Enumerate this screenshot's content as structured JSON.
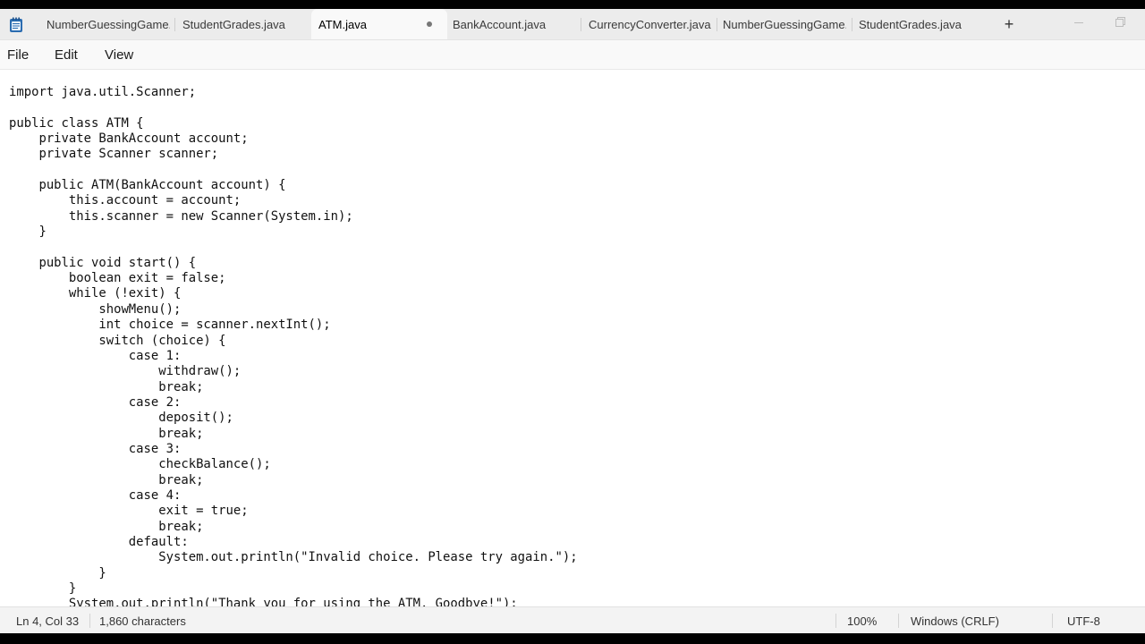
{
  "tabs": [
    {
      "label": "NumberGuessingGame.java",
      "active": false
    },
    {
      "label": "StudentGrades.java",
      "active": false
    },
    {
      "label": "ATM.java",
      "active": true
    },
    {
      "label": "BankAccount.java",
      "active": false
    },
    {
      "label": "CurrencyConverter.java",
      "active": false
    },
    {
      "label": "NumberGuessingGame.java",
      "active": false
    },
    {
      "label": "StudentGrades.java",
      "active": false
    }
  ],
  "new_tab_icon": "+",
  "menu": {
    "file": "File",
    "edit": "Edit",
    "view": "View"
  },
  "code_lines": [
    "import java.util.Scanner;",
    "",
    "public class ATM {",
    "    private BankAccount account;",
    "    private Scanner scanner;",
    "",
    "    public ATM(BankAccount account) {",
    "        this.account = account;",
    "        this.scanner = new Scanner(System.in);",
    "    }",
    "",
    "    public void start() {",
    "        boolean exit = false;",
    "        while (!exit) {",
    "            showMenu();",
    "            int choice = scanner.nextInt();",
    "            switch (choice) {",
    "                case 1:",
    "                    withdraw();",
    "                    break;",
    "                case 2:",
    "                    deposit();",
    "                    break;",
    "                case 3:",
    "                    checkBalance();",
    "                    break;",
    "                case 4:",
    "                    exit = true;",
    "                    break;",
    "                default:",
    "                    System.out.println(\"Invalid choice. Please try again.\");",
    "            }",
    "        }",
    "        System.out.println(\"Thank you for using the ATM. Goodbye!\");"
  ],
  "status": {
    "position": "Ln 4, Col 33",
    "characters": "1,860 characters",
    "zoom": "100%",
    "line_ending": "Windows (CRLF)",
    "encoding": "UTF-8"
  },
  "colors": {
    "tabbar_bg": "#ececec",
    "active_tab_bg": "#f9f9f9",
    "editor_bg": "#ffffff",
    "statusbar_bg": "#f3f3f3",
    "app_icon": "#2b6cb0"
  },
  "icons": {
    "app": "notepad-icon",
    "unsaved": "unsaved-dot-icon",
    "new_tab": "plus-icon",
    "minimize": "minimize-icon",
    "restore": "restore-icon"
  }
}
